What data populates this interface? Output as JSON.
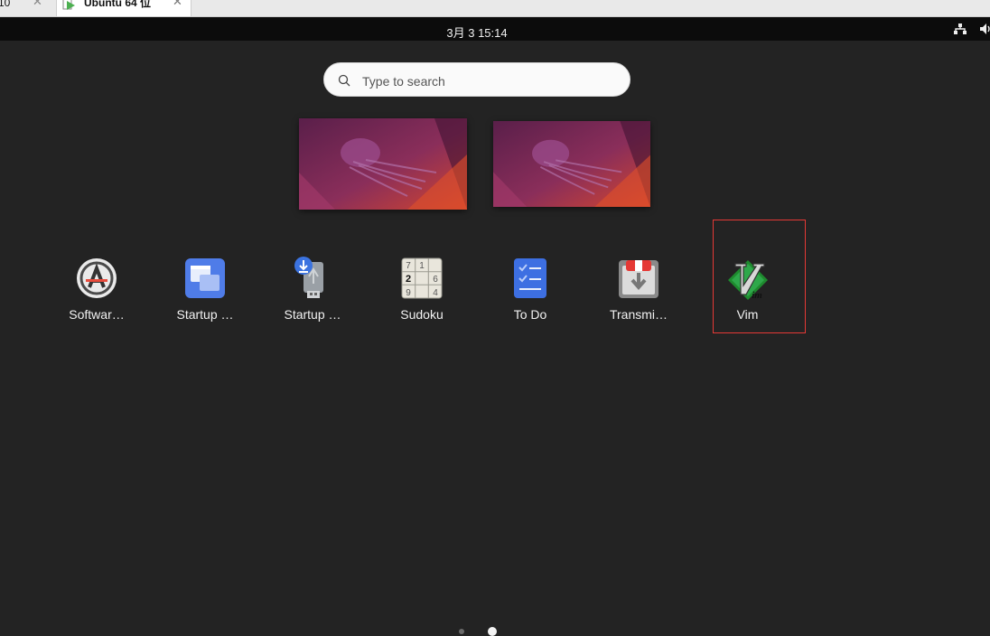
{
  "host_tabs": [
    {
      "title": "10"
    },
    {
      "title": "Ubuntu 64 位"
    }
  ],
  "topbar": {
    "clock": "3月 3  15:14"
  },
  "search": {
    "placeholder": "Type to search",
    "value": ""
  },
  "apps": [
    {
      "label": "Softwar…",
      "icon": "software-updater-icon"
    },
    {
      "label": "Startup …",
      "icon": "startup-applications-icon"
    },
    {
      "label": "Startup …",
      "icon": "startup-disk-creator-icon"
    },
    {
      "label": "Sudoku",
      "icon": "sudoku-icon"
    },
    {
      "label": "To Do",
      "icon": "todo-icon"
    },
    {
      "label": "Transmi…",
      "icon": "transmission-icon"
    },
    {
      "label": "Vim",
      "icon": "vim-icon"
    }
  ],
  "sudoku_digits": [
    "7",
    "1",
    "2",
    "6",
    "9",
    "4"
  ],
  "colors": {
    "background": "#232323",
    "topbar": "#0c0c0c",
    "selection": "#e53935"
  }
}
